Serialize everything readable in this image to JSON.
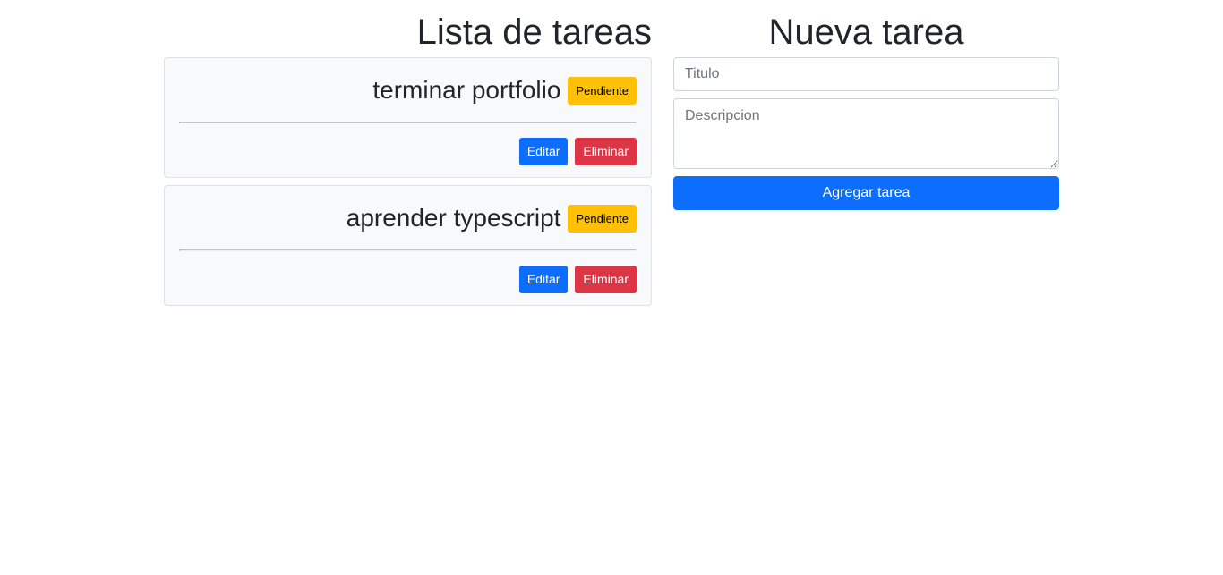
{
  "task_list": {
    "title": "Lista de tareas",
    "tasks": [
      {
        "title": "terminar portfolio",
        "status": "Pendiente",
        "edit_label": "Editar",
        "delete_label": "Eliminar"
      },
      {
        "title": "aprender typescript",
        "status": "Pendiente",
        "edit_label": "Editar",
        "delete_label": "Eliminar"
      }
    ]
  },
  "new_task": {
    "title": "Nueva tarea",
    "title_input": {
      "value": "",
      "placeholder": "Titulo"
    },
    "description_input": {
      "value": "",
      "placeholder": "Descripcion"
    },
    "submit_label": "Agregar tarea"
  },
  "colors": {
    "primary": "#0d6efd",
    "danger": "#dc3545",
    "warning": "#ffc107",
    "card_background": "#f8f9fa"
  }
}
